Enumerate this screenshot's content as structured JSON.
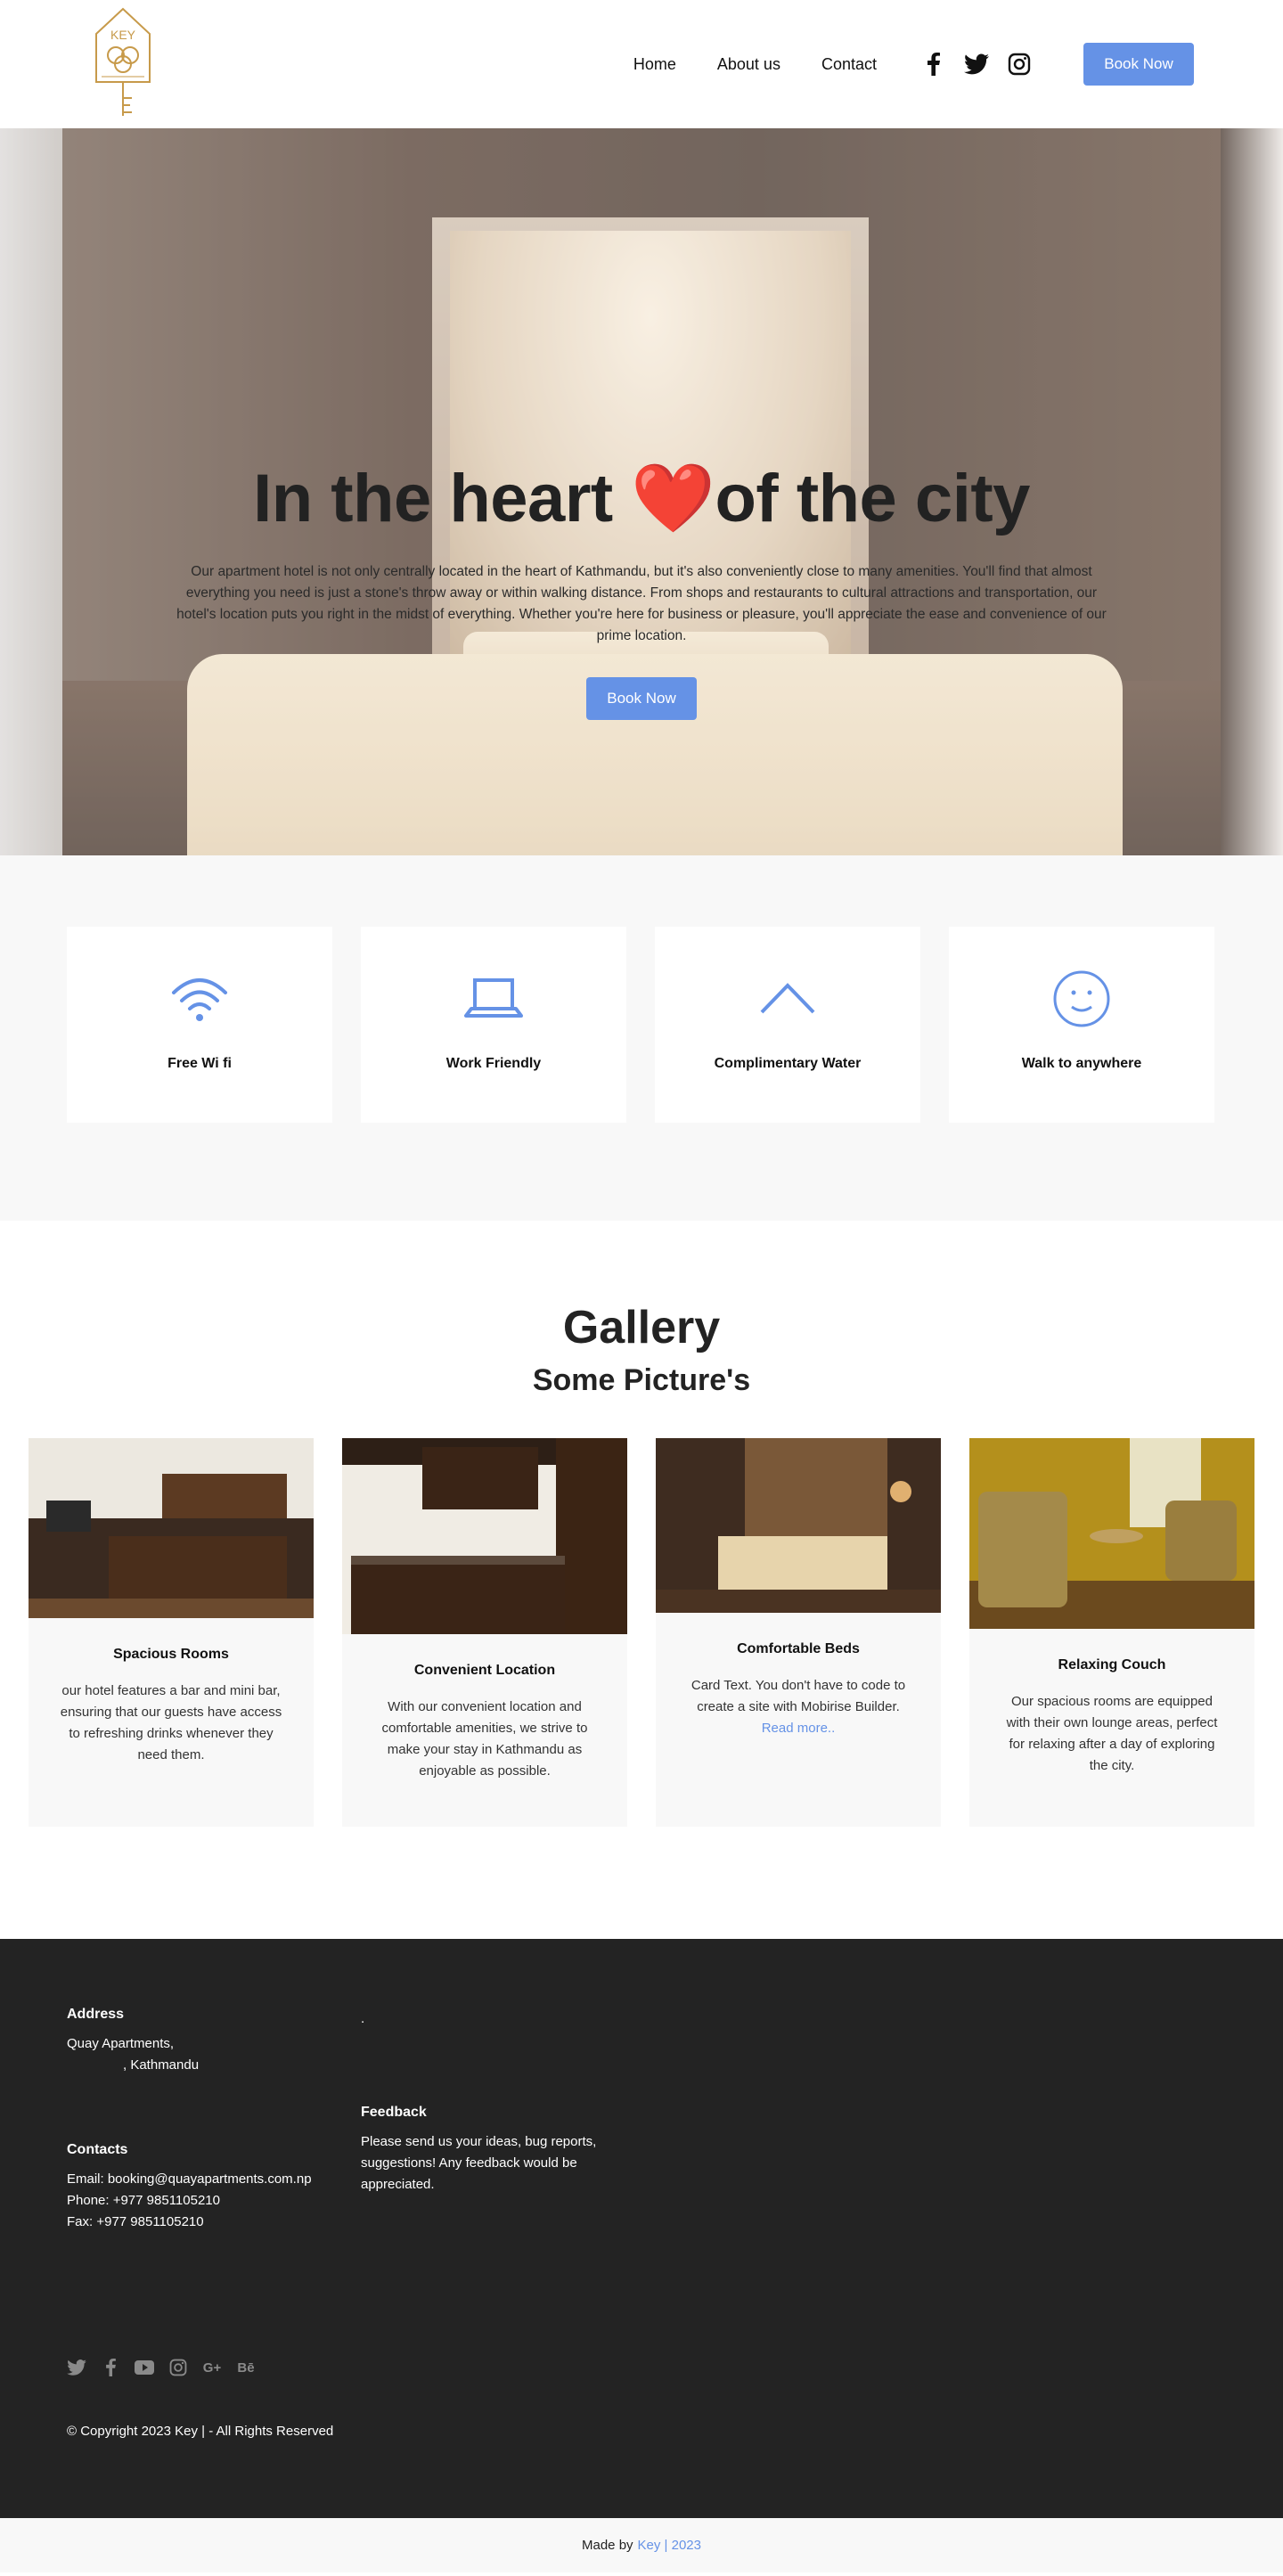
{
  "header": {
    "logo_text": "KEY",
    "nav": [
      "Home",
      "About us",
      "Contact"
    ],
    "social_icons": [
      "facebook-icon",
      "twitter-icon",
      "instagram-icon"
    ],
    "book_button": "Book Now"
  },
  "hero": {
    "title_part1": "In the heart ",
    "title_heart": "❤️",
    "title_part2": "of the city",
    "text": "Our apartment hotel is not only centrally located in the heart of Kathmandu, but it's also conveniently close to many amenities. You'll find that almost everything you need is just a stone's throw away or within walking distance. From shops and restaurants to cultural attractions and transportation, our hotel's location puts you right in the midst of everything. Whether you're here for business or pleasure, you'll appreciate the ease and convenience of our prime location.",
    "button": "Book Now"
  },
  "features": [
    {
      "label": "Free Wi fi",
      "icon": "wifi-icon"
    },
    {
      "label": "Work Friendly",
      "icon": "laptop-icon"
    },
    {
      "label": "Complimentary Water",
      "icon": "chevron-up-icon"
    },
    {
      "label": "Walk to anywhere",
      "icon": "smile-icon"
    }
  ],
  "gallery": {
    "title": "Gallery",
    "subtitle": "Some Picture's",
    "cards": [
      {
        "title": "Spacious Rooms",
        "text": "our hotel features a bar and mini bar, ensuring that our guests have access to refreshing drinks whenever they need them."
      },
      {
        "title": "Convenient Location",
        "text": "With our convenient location and comfortable amenities, we strive to make your stay in Kathmandu as enjoyable as possible."
      },
      {
        "title": "Comfortable Beds",
        "text": "Card Text. You don't have to code to create a site with Mobirise Builder.",
        "link": "Read more.."
      },
      {
        "title": "Relaxing Couch",
        "text": "Our spacious rooms are equipped with their own lounge areas, perfect for relaxing after a day of exploring the city."
      }
    ]
  },
  "footer": {
    "address_heading": "Address",
    "address_line1": "Quay Apartments,",
    "address_line2": ", Kathmandu",
    "dot": ".",
    "contacts_heading": "Contacts",
    "email": "Email: booking@quayapartments.com.np",
    "phone": "Phone: +977 9851105210",
    "fax": "Fax: +977 9851105210",
    "feedback_heading": "Feedback",
    "feedback_text": "Please send us your ideas, bug reports, suggestions! Any feedback would be appreciated.",
    "social_icons": [
      "twitter-icon",
      "facebook-icon",
      "youtube-icon",
      "instagram-icon",
      "google-plus-icon",
      "behance-icon"
    ],
    "google_plus_glyph": "G+",
    "behance_glyph": "Bē",
    "copyright": "© Copyright 2023 Key | - All Rights Reserved"
  },
  "bottom_bar": {
    "made_by": "Made by",
    "brand": "Key | 2023"
  },
  "colors": {
    "accent": "#6592e6",
    "footer_bg": "#232323",
    "section_bg": "#f8f8f8",
    "logo_gold": "#c79a4a"
  }
}
